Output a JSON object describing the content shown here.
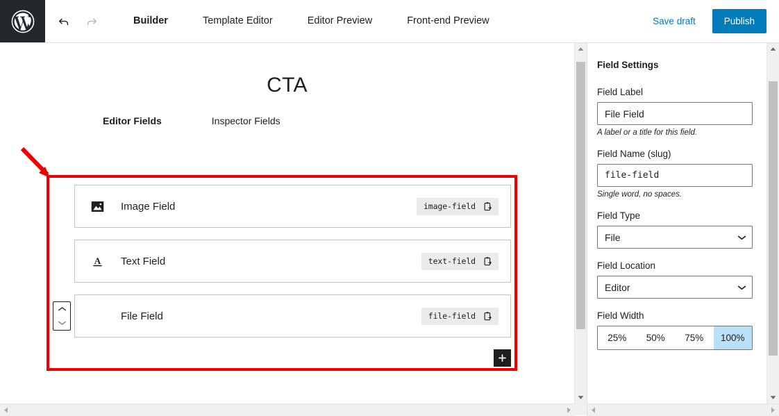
{
  "header": {
    "logo_icon": "wordpress-icon",
    "undo_icon": "undo-arrow-icon",
    "redo_icon": "redo-arrow-icon",
    "tabs": [
      {
        "label": "Builder",
        "active": true
      },
      {
        "label": "Template Editor",
        "active": false
      },
      {
        "label": "Editor Preview",
        "active": false
      },
      {
        "label": "Front-end Preview",
        "active": false
      }
    ],
    "save_draft_label": "Save draft",
    "publish_label": "Publish",
    "publish_color": "#007cba",
    "link_color": "#007cba"
  },
  "editor": {
    "title": "CTA",
    "field_tabs": [
      {
        "label": "Editor Fields",
        "active": true
      },
      {
        "label": "Inspector Fields",
        "active": false
      }
    ],
    "add_field_label": "+",
    "annotation_color": "#ee0000",
    "fields": [
      {
        "label": "Image Field",
        "slug": "image-field",
        "icon": "image-icon",
        "copy_icon": "copy-to-clipboard-icon",
        "selected": false
      },
      {
        "label": "Text Field",
        "slug": "text-field",
        "icon": "text-format-icon",
        "copy_icon": "copy-to-clipboard-icon",
        "selected": false
      },
      {
        "label": "File Field",
        "slug": "file-field",
        "icon": "none",
        "copy_icon": "copy-to-clipboard-icon",
        "selected": true
      }
    ],
    "mover": {
      "up_icon": "chevron-up-icon",
      "down_icon": "chevron-down-icon"
    }
  },
  "sidebar": {
    "panel_title": "Field Settings",
    "field_label": {
      "label": "Field Label",
      "value": "File Field",
      "help": "A label or a title for this field."
    },
    "field_name": {
      "label": "Field Name (slug)",
      "value": "file-field",
      "help": "Single word, no spaces."
    },
    "field_type": {
      "label": "Field Type",
      "value": "File",
      "options": [
        "File"
      ]
    },
    "field_location": {
      "label": "Field Location",
      "value": "Editor",
      "options": [
        "Editor"
      ]
    },
    "field_width": {
      "label": "Field Width",
      "options": [
        "25%",
        "50%",
        "75%",
        "100%"
      ],
      "selected": "100%",
      "selected_color": "#b9e0f7"
    }
  }
}
